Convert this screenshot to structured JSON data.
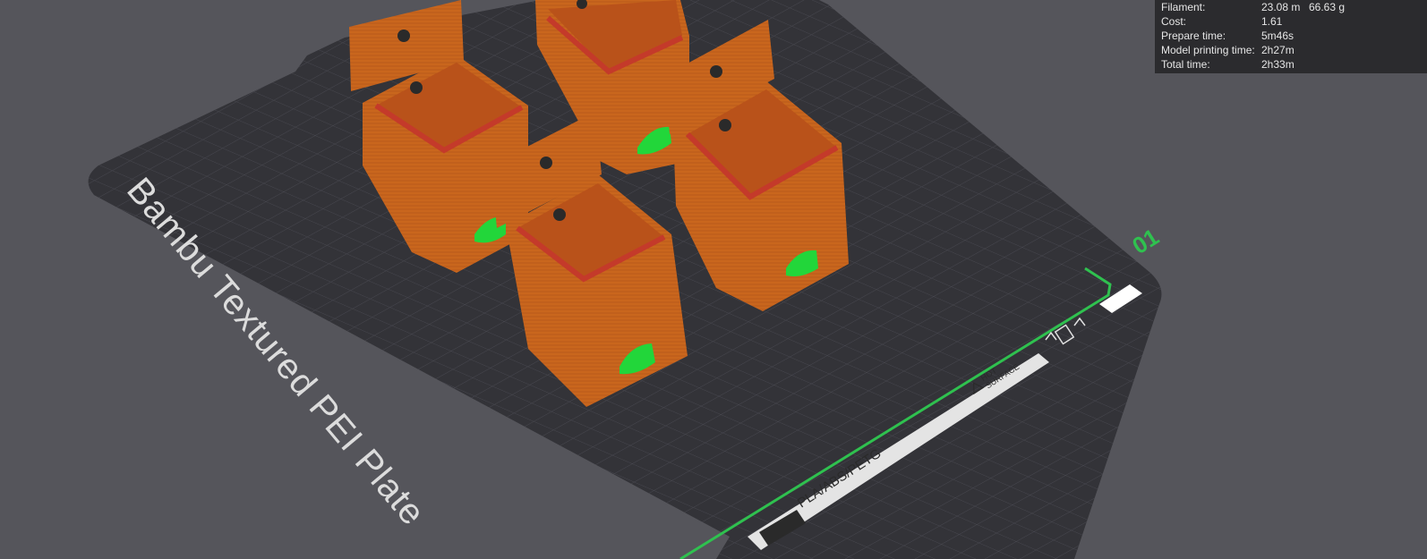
{
  "viewport": {
    "plate_name": "Bambu Textured PEI Plate",
    "plate_number": "01",
    "filament_type_label": "PLA/ABS/PETG",
    "hot_surface_line1": "HOT",
    "hot_surface_line2": "SURFACE"
  },
  "stats": {
    "rows": [
      {
        "label": "Filament:",
        "value": "23.08 m",
        "value2": "66.63 g"
      },
      {
        "label": "Cost:",
        "value": "1.61"
      },
      {
        "label": "Prepare time:",
        "value": "5m46s"
      },
      {
        "label": "Model printing time:",
        "value": "2h27m"
      },
      {
        "label": "Total time:",
        "value": "2h33m"
      }
    ]
  },
  "colors": {
    "background": "#55555b",
    "plate": "#333338",
    "part_orange": "#c9661d",
    "part_red": "#c43a2a",
    "support_green": "#22d63a",
    "accent_green": "#2fc14f"
  }
}
